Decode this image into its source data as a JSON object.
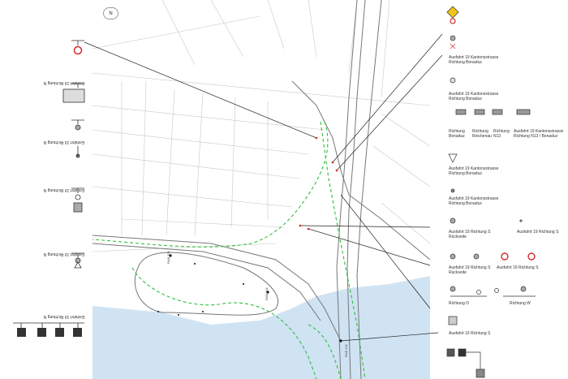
{
  "map": {
    "north_label": "N",
    "colors": {
      "water": "#cfe3f3",
      "route": "#2fbf3a",
      "road": "#777777",
      "parcel": "#c8c8c8",
      "leader": "#222222",
      "sign_red": "#d42a2a"
    },
    "road_tags": [
      "RAB 101",
      "RAB 101",
      "RAB 101"
    ]
  },
  "left_labels": [
    "Einfahrt 19 Richtung N",
    "Einfahrt 19 Richtung N",
    "Einfahrt 19 Richtung N",
    "Einfahrt 19 Richtung N",
    "Einfahrt 19 Richtung N"
  ],
  "right_labels": {
    "exit_a": "Ausfahrt 19 Kantonsstrasse\nRichtung Bonaduz",
    "exit_b": "Ausfahrt 19 Kantonsstrasse\nRichtung Bonaduz",
    "dir_bonaduz": "Richtung\nBonaduz",
    "dir_reichenau": "Richtung\nReichenau",
    "dir_n13": "Richtung\nN13",
    "dir_n13_bonaduz": "Ausfahrt 19 Kantonsstrasse\nRichtung N13 / Bonaduz",
    "exit_c": "Ausfahrt 19 Kantonsstrasse\nRichtung Bonaduz",
    "exit_d": "Ausfahrt 19 Kantonsstrasse\nRichtung Bonaduz",
    "exit_s_back": "Ausfahrt 19 Richtung S\nRückseite",
    "exit_s_1": "Ausfahrt 19 Richtung S",
    "exit_s_back_2": "Ausfahrt 19 Richtung S\nRückseite",
    "exit_s_2": "Ausfahrt 19 Richtung S",
    "dir_o": "Richtung O",
    "dir_w": "Richtung W",
    "exit_s_3": "Ausfahrt 19 Richtung S"
  }
}
